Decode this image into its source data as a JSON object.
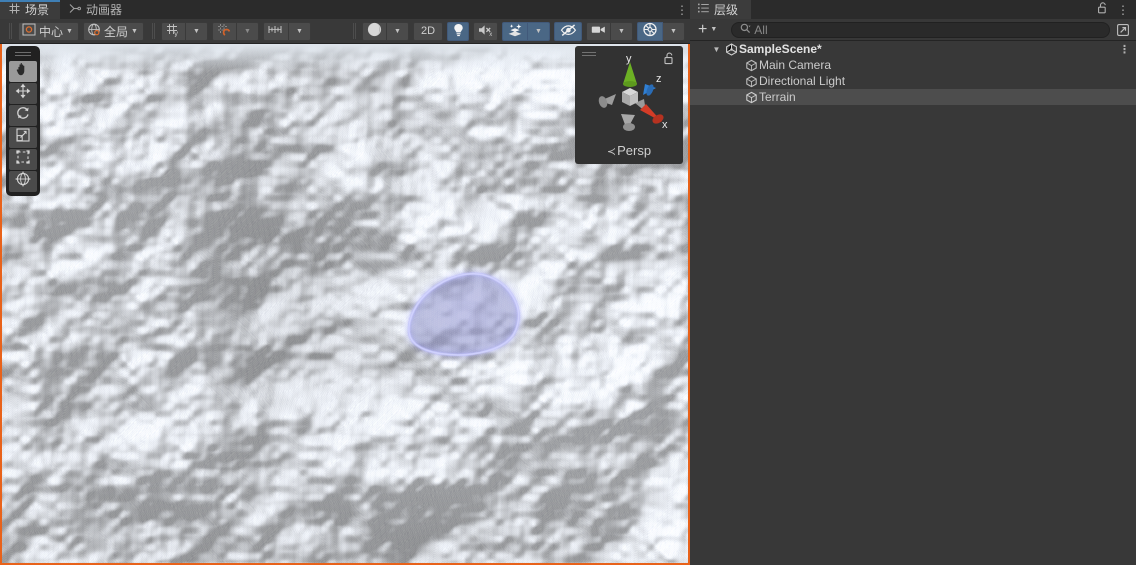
{
  "scene_view": {
    "tabs": [
      {
        "label": "场景",
        "icon": "grid-icon",
        "active": true
      },
      {
        "label": "动画器",
        "icon": "animator-icon",
        "active": false
      }
    ],
    "kebab": "⋮",
    "toolbar": {
      "pivot_label": "中心",
      "pivot_icon": "pivot-center-icon",
      "space_label": "全局",
      "space_icon": "globe-icon",
      "grid_axis_icon": "grid-axis-y-icon",
      "grid_snap_icon": "grid-snap-magnet-icon",
      "grid_size_icon": "grid-increment-icon",
      "shading_icon": "shading-sphere-icon",
      "twod_label": "2D",
      "light_icon": "lightbulb-icon",
      "audio_icon": "audio-mute-icon",
      "fx_icon": "effects-icon",
      "visibility_icon": "scene-visibility-off-icon",
      "camera_icon": "camera-icon",
      "gizmos_icon": "gizmos-globe-icon",
      "caret": "▼"
    },
    "tools": [
      {
        "name": "hand-tool",
        "icon": "hand-icon",
        "active": true
      },
      {
        "name": "move-tool",
        "icon": "move-arrows-icon",
        "active": false
      },
      {
        "name": "rotate-tool",
        "icon": "rotate-icon",
        "active": false
      },
      {
        "name": "scale-tool",
        "icon": "scale-icon",
        "active": false
      },
      {
        "name": "rect-tool",
        "icon": "rect-transform-icon",
        "active": false
      },
      {
        "name": "transform-tool",
        "icon": "transform-combined-icon",
        "active": false
      }
    ],
    "gizmo": {
      "persp_label": "Persp",
      "persp_arrow": "≺",
      "lock_icon": "unlock-icon",
      "axis_x": "x",
      "axis_y": "y",
      "axis_z": "z",
      "axis_x_color": "#d43c27",
      "axis_y_color": "#6cb024",
      "axis_z_color": "#2f7fd4"
    },
    "selection_outline_color": "#b8b9f2",
    "border_color": "#e8621a",
    "sky_color": "#dfe5ec"
  },
  "hierarchy": {
    "tab_label": "层级",
    "tab_icon": "hierarchy-list-icon",
    "lock_icon": "unlock-icon",
    "kebab": "⋮",
    "add_label": "+",
    "add_caret": "▼",
    "search_icon": "search-icon",
    "search_caret": "▾",
    "search_placeholder": "All",
    "search_value": "",
    "expand_icon": "expand-window-icon",
    "rows": [
      {
        "label": "SampleScene*",
        "icon": "unity-scene-icon",
        "depth": 0,
        "expanded": true,
        "selected": false,
        "kebab": "⋮"
      },
      {
        "label": "Main Camera",
        "icon": "gameobject-cube-icon",
        "depth": 1,
        "selected": false
      },
      {
        "label": "Directional Light",
        "icon": "gameobject-cube-icon",
        "depth": 1,
        "selected": false
      },
      {
        "label": "Terrain",
        "icon": "gameobject-cube-icon",
        "depth": 1,
        "selected": true
      }
    ]
  }
}
